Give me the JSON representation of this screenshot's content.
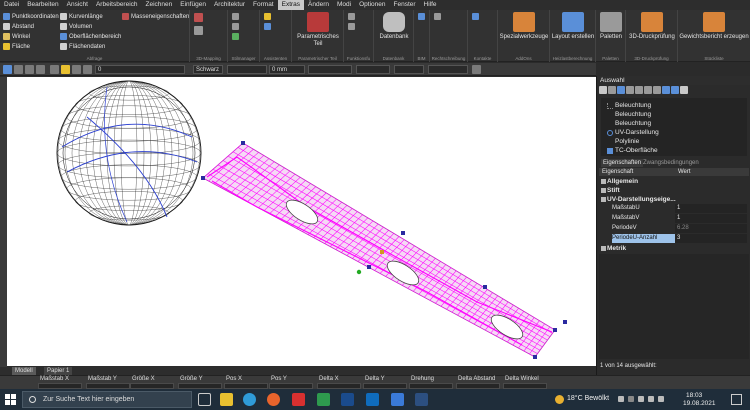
{
  "menu": {
    "items": [
      "Datei",
      "Bearbeiten",
      "Ansicht",
      "Arbeitsbereich",
      "Zeichnen",
      "Einfügen",
      "Architektur",
      "Format",
      "Extras",
      "Ändern",
      "Modi",
      "Optionen",
      "Fenster",
      "Hilfe"
    ],
    "active": "Extras"
  },
  "ribbon": {
    "abfrage": {
      "label": "Abfrage",
      "col1": [
        "Punktkoordinaten",
        "Abstand",
        "Winkel",
        "Fläche"
      ],
      "col2": [
        "Kurvenlänge",
        "Volumen",
        "Oberflächenbereich",
        "Flächendaten"
      ],
      "col3": [
        "Masseneigenschaften"
      ]
    },
    "group_labels": [
      "3D-Mapping",
      "Stilmanager",
      "Assistenten",
      "Parametrischer Teil",
      "Funktionsfu",
      "Datenbank",
      "BIM",
      "Rechtschreibung",
      "Kontakte",
      "AddOns",
      "Heizlastberechnung",
      "Paletten",
      "3D-Druckprüfung",
      "Stückliste"
    ],
    "parametrisches_teil": "Parametrisches Teil",
    "datenbank": "Datenbank",
    "spezialwerkzeuge": "Spezialwerkzeuge",
    "layout_erstellen": "Layout erstellen",
    "paletten": "Paletten",
    "druckpruefung": "3D-Druckprüfung",
    "gewichtsbericht": "Gewichtsbericht erzeugen"
  },
  "toolbar": {
    "layer_value": "0",
    "color_value": "Schwarz",
    "linewidth_value": "0 mm"
  },
  "view_tabs": [
    "Modell",
    "Papier 1"
  ],
  "status": {
    "headers": [
      "Maßstab X",
      "Maßstab Y",
      "Größe X",
      "Größe Y",
      "Pos X",
      "Pos Y",
      "Delta X",
      "Delta Y",
      "Drehung",
      "Delta Abstand",
      "Delta Winkel"
    ],
    "selection_info": "1 von 14 ausgewählt:"
  },
  "auswahl": {
    "title": "Auswahl",
    "tree": [
      "Beleuchtung",
      "Beleuchtung",
      "Beleuchtung",
      "UV-Darstellung",
      "Polylinie",
      "TC-Oberfläche"
    ]
  },
  "properties": {
    "tabs": [
      "Eigenschaften",
      "Zwangsbedingungen"
    ],
    "col_property": "Eigenschaft",
    "col_value": "Wert",
    "sections": [
      "Allgemein",
      "Stift",
      "UV-Darstellungseige..."
    ],
    "rows": [
      {
        "name": "MaßstabU",
        "value": "1"
      },
      {
        "name": "MaßstabV",
        "value": "1"
      },
      {
        "name": "PeriodeV",
        "value": "6.28"
      },
      {
        "name": "PeriodeU-Anzahl",
        "value": "3"
      }
    ],
    "metrik": "Metrik"
  },
  "taskbar": {
    "search_placeholder": "Zur Suche Text hier eingeben",
    "weather": "18°C Bewölkt",
    "time": "18:03",
    "date": "19.08.2021"
  },
  "colors": {
    "accent": "#ff00ff",
    "selection": "#1c4f8a",
    "grip": "#2a2aa0"
  }
}
